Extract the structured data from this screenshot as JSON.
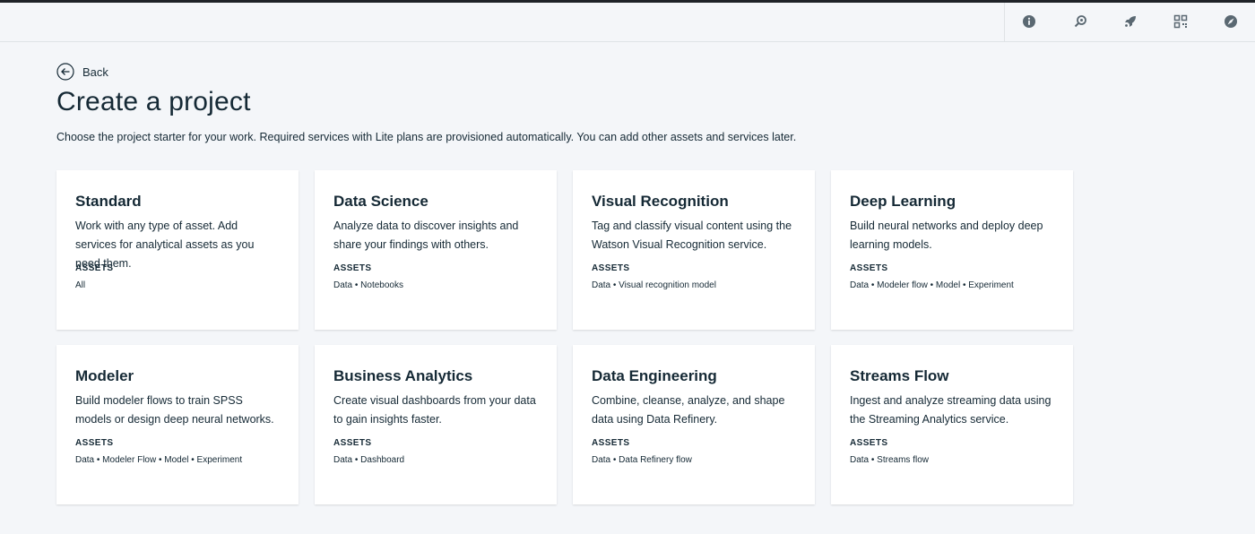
{
  "header": {
    "icons": [
      "info-icon",
      "catalog-refresh-icon",
      "rocket-icon",
      "grid-apps-icon",
      "compass-icon"
    ]
  },
  "nav": {
    "back_label": "Back"
  },
  "page": {
    "title": "Create a project",
    "description": "Choose the project starter for your work. Required services with Lite plans are provisioned automatically. You can add other assets and services later."
  },
  "cards": [
    {
      "title": "Standard",
      "description": "Work with any type of asset. Add services for analytical assets as you need them.",
      "assets_label": "ASSETS",
      "assets": "All"
    },
    {
      "title": "Data Science",
      "description": "Analyze data to discover insights and share your findings with others.",
      "assets_label": "ASSETS",
      "assets": "Data • Notebooks"
    },
    {
      "title": "Visual Recognition",
      "description": "Tag and classify visual content using the Watson Visual Recognition service.",
      "assets_label": "ASSETS",
      "assets": "Data • Visual recognition model"
    },
    {
      "title": "Deep Learning",
      "description": "Build neural networks and deploy deep learning models.",
      "assets_label": "ASSETS",
      "assets": "Data • Modeler flow • Model • Experiment"
    },
    {
      "title": "Modeler",
      "description": "Build modeler flows to train SPSS models or design deep neural networks.",
      "assets_label": "ASSETS",
      "assets": "Data • Modeler Flow • Model • Experiment"
    },
    {
      "title": "Business Analytics",
      "description": "Create visual dashboards from your data to gain insights faster.",
      "assets_label": "ASSETS",
      "assets": "Data • Dashboard"
    },
    {
      "title": "Data Engineering",
      "description": "Combine, cleanse, analyze, and shape data using Data Refinery.",
      "assets_label": "ASSETS",
      "assets": "Data • Data Refinery flow"
    },
    {
      "title": "Streams Flow",
      "description": "Ingest and analyze streaming data using the Streaming Analytics service.",
      "assets_label": "ASSETS",
      "assets": "Data • Streams flow"
    }
  ],
  "colors": {
    "background": "#f4f6f9",
    "text": "#152935",
    "card": "#ffffff",
    "icon": "#5a6872"
  }
}
